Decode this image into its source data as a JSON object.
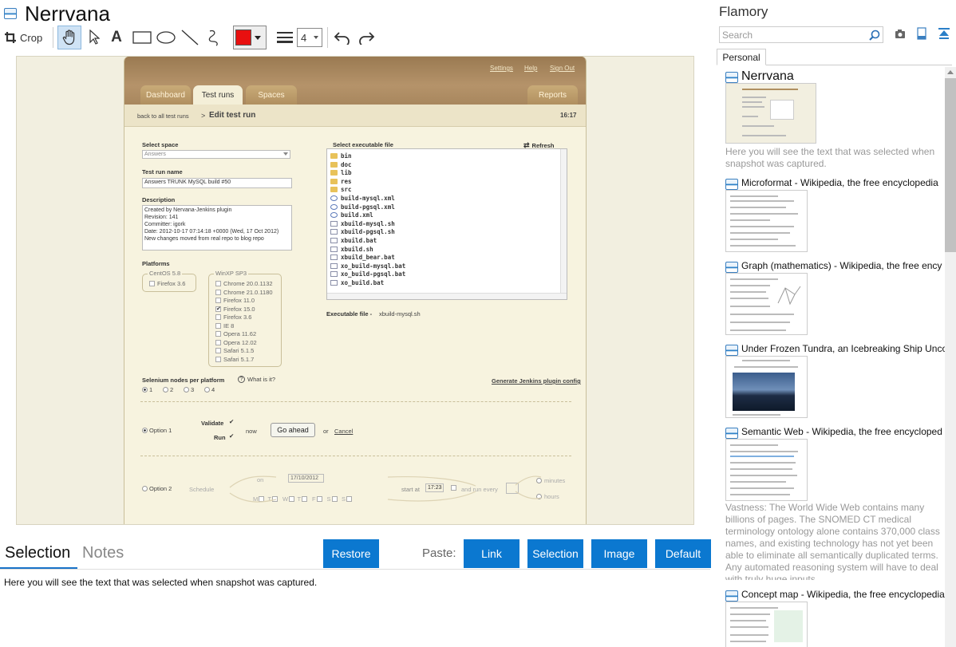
{
  "header": {
    "title": "Nerrvana"
  },
  "toolbar": {
    "crop_label": "Crop",
    "color": "#e81010",
    "line_width": "4"
  },
  "canvas": {
    "top_links": [
      "Settings",
      "Help",
      "Sign Out"
    ],
    "tabs": [
      "Dashboard",
      "Test runs",
      "Spaces"
    ],
    "reports_tab": "Reports",
    "breadcrumb_link": "back to all test runs",
    "breadcrumb_sep": ">",
    "page_title": "Edit test run",
    "time": "16:17",
    "select_space_label": "Select space",
    "select_space_value": "Answers",
    "test_run_name_label": "Test run name",
    "test_run_name_value": "Answers TRUNK MySQL build #50",
    "description_label": "Description",
    "description_lines": [
      "Created by Nervana-Jenkins plugin",
      "Revision: 141",
      "Committer: igork",
      "Date: 2012-10-17 07:14:18 +0000 (Wed, 17 Oct 2012)",
      "New changes moved from real repo to blog repo"
    ],
    "platforms_label": "Platforms",
    "centos": {
      "title": "CentOS 5.8",
      "items": [
        "Firefox 3.6"
      ]
    },
    "winxp": {
      "title": "WinXP SP3",
      "items": [
        "Chrome 20.0.1132",
        "Chrome 21.0.1180",
        "Firefox 11.0",
        "Firefox 15.0",
        "Firefox 3.6",
        "IE 8",
        "Opera 11.62",
        "Opera 12.02",
        "Safari 5.1.5",
        "Safari 5.1.7"
      ],
      "checked": "Firefox 15.0"
    },
    "select_exec_label": "Select executable file",
    "refresh_label": "Refresh",
    "files": [
      {
        "name": "bin",
        "type": "folder"
      },
      {
        "name": "doc",
        "type": "folder"
      },
      {
        "name": "lib",
        "type": "folder"
      },
      {
        "name": "res",
        "type": "folder"
      },
      {
        "name": "src",
        "type": "folder"
      },
      {
        "name": "build-mysql.xml",
        "type": "xml"
      },
      {
        "name": "build-pgsql.xml",
        "type": "xml"
      },
      {
        "name": "build.xml",
        "type": "xml"
      },
      {
        "name": "xbuild-mysql.sh",
        "type": "file"
      },
      {
        "name": "xbuild-pgsql.sh",
        "type": "file"
      },
      {
        "name": "xbuild.bat",
        "type": "file"
      },
      {
        "name": "xbuild.sh",
        "type": "file"
      },
      {
        "name": "xbuild_bear.bat",
        "type": "file"
      },
      {
        "name": "xo_build-mysql.bat",
        "type": "file"
      },
      {
        "name": "xo_build-pgsql.bat",
        "type": "file"
      },
      {
        "name": "xo_build.bat",
        "type": "file"
      }
    ],
    "exec_file_label": "Executable file -",
    "exec_file_value": "xbuild-mysql.sh",
    "selenium_label": "Selenium nodes per platform",
    "what_is_it": "What is it?",
    "node_options": [
      "1",
      "2",
      "3",
      "4"
    ],
    "generate_link": "Generate Jenkins plugin config",
    "option1": "Option 1",
    "validate_label": "Validate",
    "run_label": "Run",
    "now_label": "now",
    "go_ahead": "Go ahead",
    "or_label": "or",
    "cancel_label": "Cancel",
    "option2": "Option 2",
    "schedule_label": "Schedule",
    "on_label": "on",
    "date_value": "17/10/2012",
    "start_at_label": "start at",
    "start_time": "17:23",
    "and_run_every": "and run every",
    "minutes_label": "minutes",
    "hours_label": "hours",
    "days": [
      "M",
      "T",
      "W",
      "T",
      "F",
      "S",
      "S"
    ]
  },
  "bottom": {
    "tab_selection": "Selection",
    "tab_notes": "Notes",
    "restore": "Restore",
    "paste_label": "Paste:",
    "paste_buttons": [
      "Link",
      "Selection",
      "Image",
      "Default"
    ],
    "selection_text": "Here you will see the text that was selected when snapshot was captured."
  },
  "sidebar": {
    "app_name": "Flamory",
    "search_placeholder": "Search",
    "tab_personal": "Personal",
    "items": [
      {
        "title": "Nerrvana",
        "note": "Here you will see the text that was selected when snapshot was captured."
      },
      {
        "title": "Microformat - Wikipedia, the free encyclopedia"
      },
      {
        "title": "Graph (mathematics) - Wikipedia, the free ency"
      },
      {
        "title": "Under Frozen Tundra, an Icebreaking Ship Unco"
      },
      {
        "title": "Semantic Web - Wikipedia, the free encycloped",
        "note": "Vastness: The World Wide Web contains many billions of pages. The SNOMED CT medical terminology ontology alone contains 370,000 class names, and existing technology has not yet been able to eliminate all semantically duplicated terms. Any automated reasoning system will have to deal with truly huge inputs."
      },
      {
        "title": "Concept map - Wikipedia, the free encyclopedia"
      }
    ]
  },
  "colors": {
    "accent": "#0b78d0"
  }
}
